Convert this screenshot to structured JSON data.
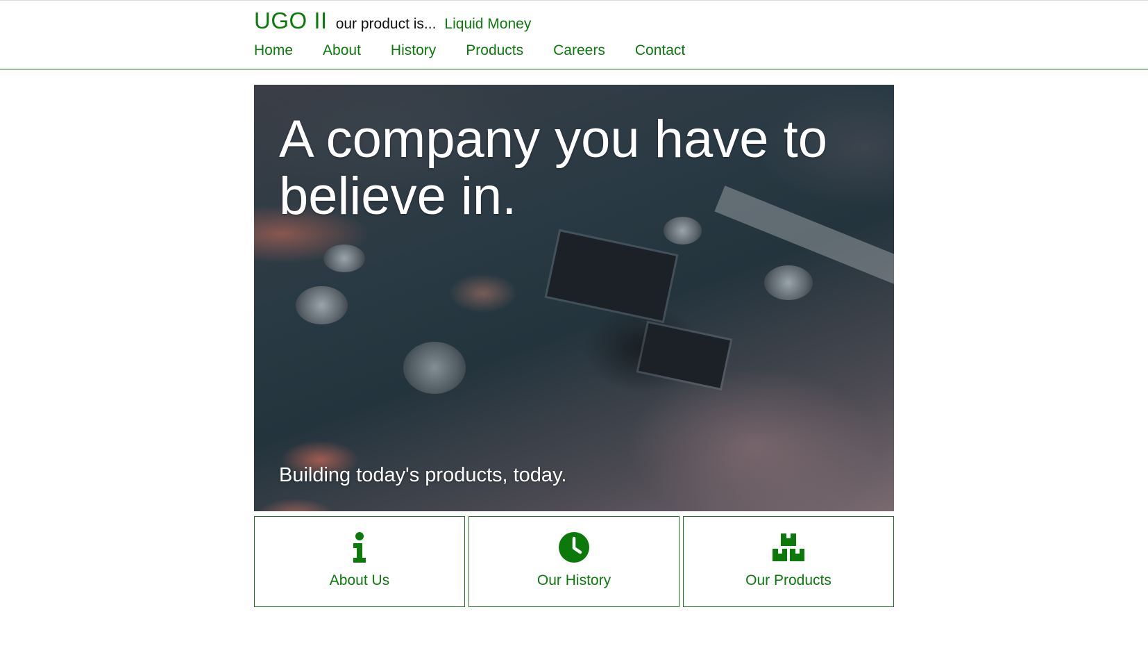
{
  "header": {
    "brand": "UGO II",
    "tagline": "our product is...",
    "product": "Liquid Money"
  },
  "nav": {
    "items": [
      {
        "label": "Home"
      },
      {
        "label": "About"
      },
      {
        "label": "History"
      },
      {
        "label": "Products"
      },
      {
        "label": "Careers"
      },
      {
        "label": "Contact"
      }
    ]
  },
  "hero": {
    "title": "A company you have to believe in.",
    "subtitle": "Building today's products, today."
  },
  "cards": [
    {
      "label": "About Us",
      "icon": "info-icon"
    },
    {
      "label": "Our History",
      "icon": "clock-icon"
    },
    {
      "label": "Our Products",
      "icon": "boxes-icon"
    }
  ],
  "colors": {
    "accent": "#0b7a0b",
    "border": "#1a7a1a",
    "background": "#ffffff"
  }
}
